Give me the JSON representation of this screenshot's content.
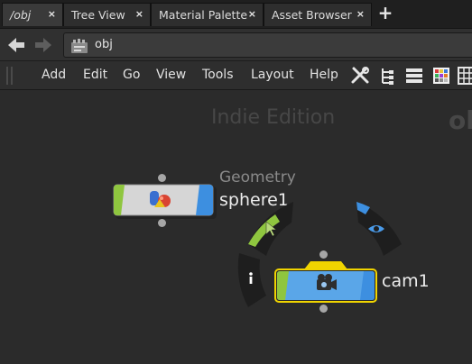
{
  "tabs": [
    {
      "label": "/obj",
      "active": true
    },
    {
      "label": "Tree View",
      "active": false
    },
    {
      "label": "Material Palette",
      "active": false
    },
    {
      "label": "Asset Browser",
      "active": false
    }
  ],
  "tab_close_glyph": "×",
  "tab_add_glyph": "+",
  "path": {
    "text": "obj",
    "icon": "network-obj-icon"
  },
  "menu": [
    "Add",
    "Edit",
    "Go",
    "View",
    "Tools",
    "Layout",
    "Help"
  ],
  "toolbar_icons": [
    "wrench-icon",
    "tree-icon",
    "list-icon",
    "color-grid-icon",
    "grid-view-icon"
  ],
  "canvas": {
    "watermark": "Indie Edition",
    "context_label": "obj"
  },
  "nodes": {
    "sphere": {
      "type_label": "Geometry",
      "name": "sphere1",
      "icon": "geometry-icon"
    },
    "cam": {
      "name": "cam1",
      "icon": "camera-icon",
      "selected": true
    }
  },
  "ring_icons": [
    "info-icon",
    "pointer-icon",
    "eye-icon"
  ],
  "colors": {
    "display_flag": "#8fc63f",
    "render_flag": "#3d8fe0",
    "camera_node": "#5aa6e8",
    "selection": "#f0d400"
  }
}
